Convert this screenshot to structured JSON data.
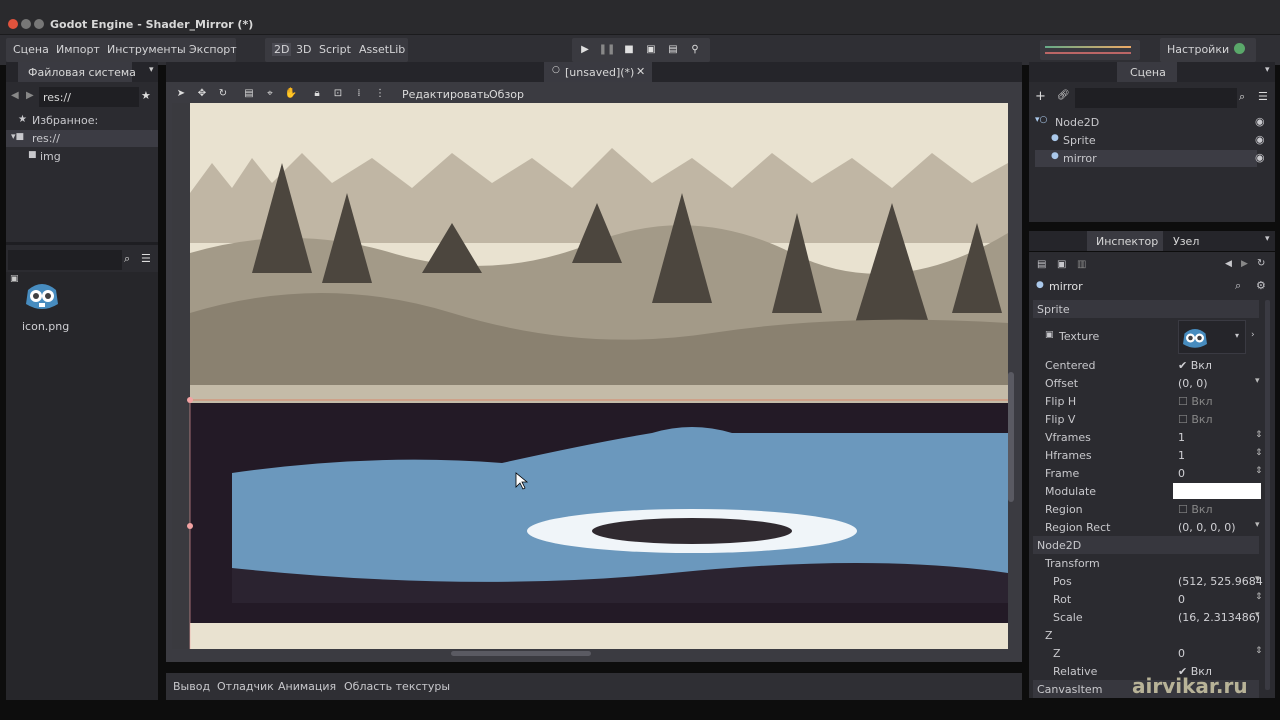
{
  "window": {
    "title": "Godot Engine - Shader_Mirror (*)"
  },
  "menu": {
    "scene": "Сцена",
    "import": "Импорт",
    "tools": "Инструменты",
    "export": "Экспорт"
  },
  "modes": {
    "m2d": "2D",
    "m3d": "3D",
    "script": "Script",
    "assetlib": "AssetLib"
  },
  "settings": {
    "label": "Настройки"
  },
  "filesystem": {
    "tab": "Файловая система",
    "path": "res://",
    "favorites": "Избранное:",
    "root": "res://",
    "folder": "img",
    "file": "icon.png"
  },
  "editor": {
    "scene_tab": "[unsaved](*)",
    "edit_menu": "Редактировать",
    "view_menu": "Обзор"
  },
  "scene": {
    "tab": "Сцена",
    "tree": [
      "Node2D",
      "Sprite",
      "mirror"
    ]
  },
  "inspector": {
    "tab_inspector": "Инспектор",
    "tab_node": "Узел",
    "object": "mirror",
    "section_sprite": "Sprite",
    "section_node2d": "Node2D",
    "section_canvas": "CanvasItem",
    "props": {
      "texture": "Texture",
      "centered": "Centered",
      "centered_val": "Вкл",
      "offset": "Offset",
      "offset_val": "(0, 0)",
      "fliph": "Flip H",
      "fliph_val": "Вкл",
      "flipv": "Flip V",
      "flipv_val": "Вкл",
      "vframes": "Vframes",
      "vframes_val": "1",
      "hframes": "Hframes",
      "hframes_val": "1",
      "frame": "Frame",
      "frame_val": "0",
      "modulate": "Modulate",
      "region": "Region",
      "region_val": "Вкл",
      "regionrect": "Region Rect",
      "regionrect_val": "(0, 0, 0, 0)",
      "transform": "Transform",
      "pos": "Pos",
      "pos_val": "(512, 525.9684",
      "rot": "Rot",
      "rot_val": "0",
      "scale": "Scale",
      "scale_val": "(16, 2.313486)",
      "z": "Z",
      "zz": "Z",
      "zz_val": "0",
      "relative": "Relative",
      "relative_val": "Вкл"
    }
  },
  "bottom": {
    "output": "Вывод",
    "debugger": "Отладчик",
    "animation": "Анимация",
    "texture_region": "Область текстуры"
  },
  "watermark": "airvikar.ru",
  "colors": {
    "water": "#6b98bd",
    "dark": "#231a26",
    "paper": "#e9e2d0"
  }
}
